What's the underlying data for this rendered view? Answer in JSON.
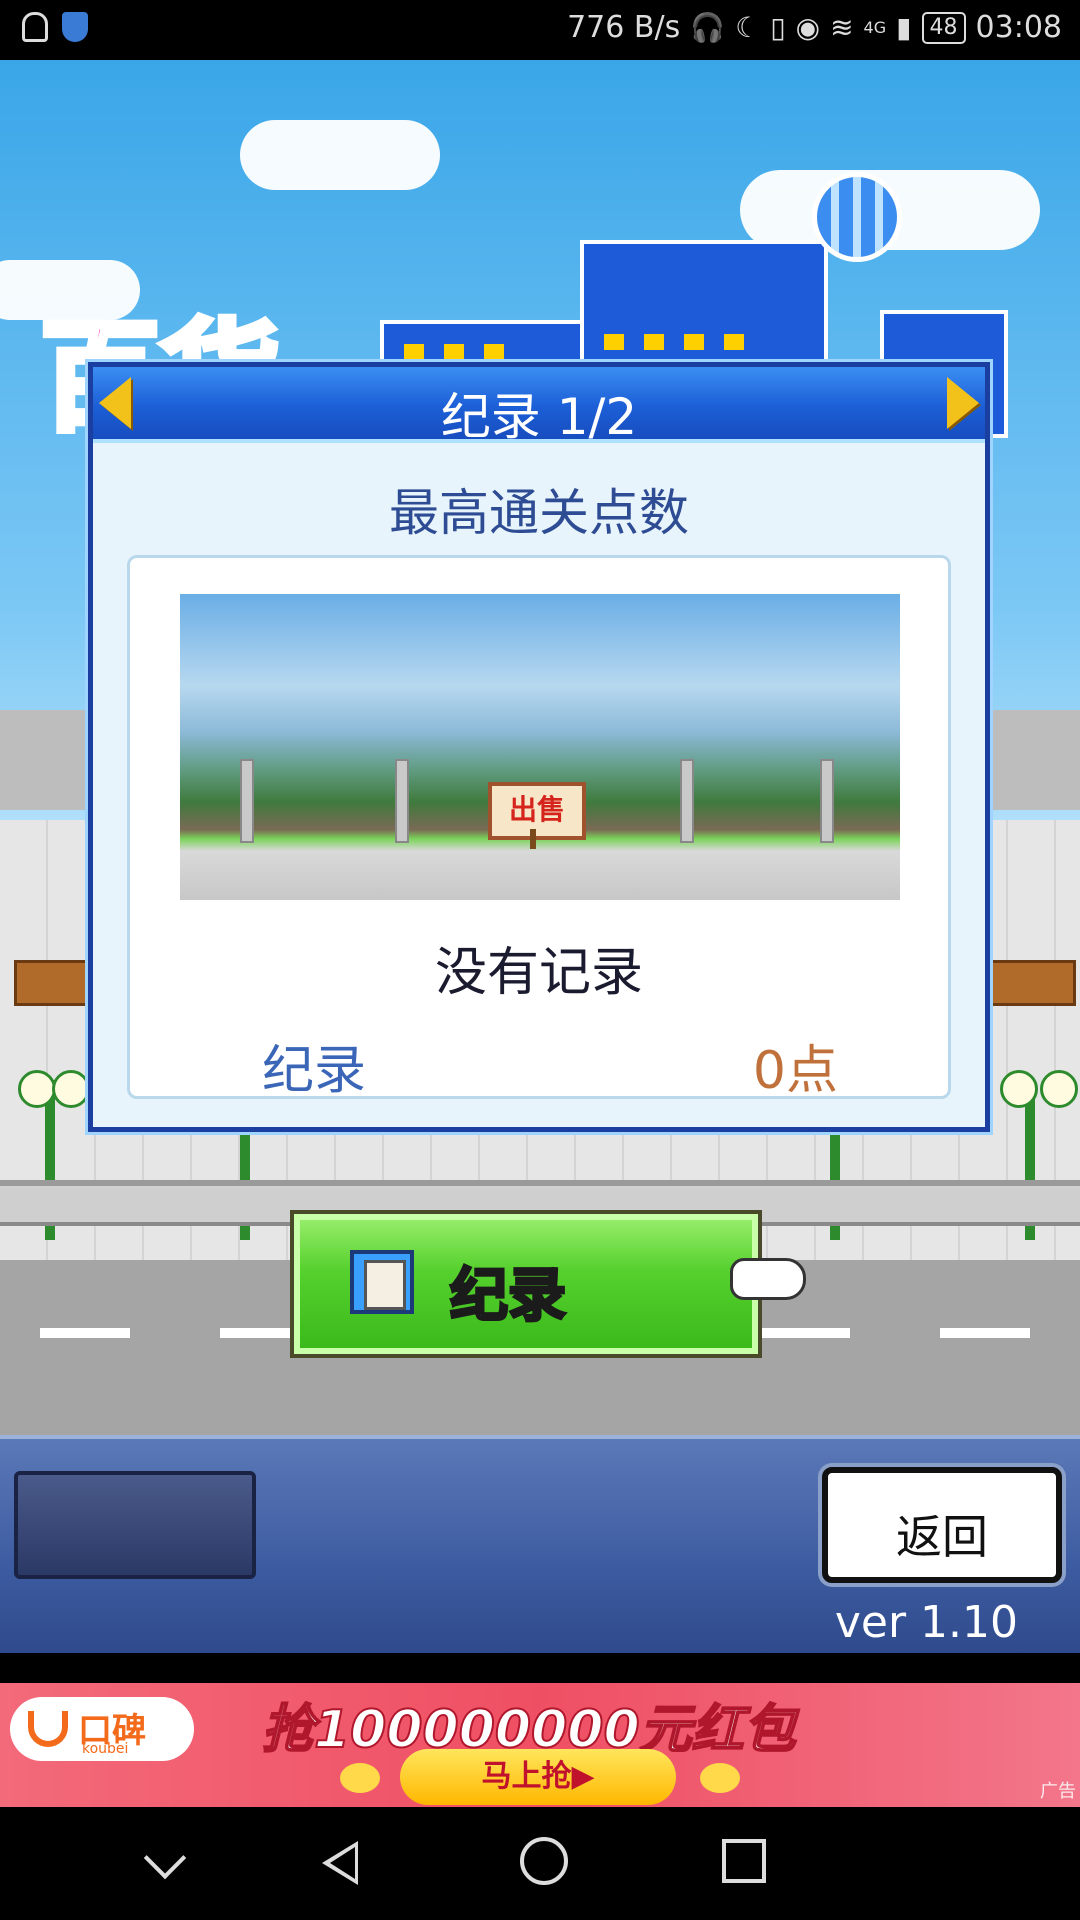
{
  "status_bar": {
    "net_speed": "776 B/s",
    "network": "4G",
    "battery": "48",
    "time": "03:08",
    "icons": [
      "notification-bell-icon",
      "shield-app-icon",
      "headset-icon",
      "moon-icon",
      "vibrate-icon",
      "eye-icon",
      "wifi-icon",
      "signal-icon",
      "battery-icon"
    ]
  },
  "background": {
    "logo_text": "百货"
  },
  "dialog": {
    "title": "纪录 1/2",
    "subtitle": "最高通关点数",
    "scene_sign": "出售",
    "no_record": "没有记录",
    "record_label": "纪录",
    "record_value": "0点",
    "colors": {
      "header": "#1c5fd6",
      "label": "#3b66b8",
      "value": "#c0703a"
    }
  },
  "main_button": {
    "label": "纪录",
    "color": "#56d12e"
  },
  "bottom_panel": {
    "back_label": "返回",
    "version": "ver 1.10"
  },
  "ad": {
    "brand": "口碑",
    "brand_sub": "koubei",
    "headline": "抢100000000元红包",
    "cta": "马上抢▶",
    "tag": "广告"
  },
  "nav": {
    "icons": [
      "chevron-down-icon",
      "back-triangle-icon",
      "home-circle-icon",
      "recents-square-icon"
    ]
  }
}
